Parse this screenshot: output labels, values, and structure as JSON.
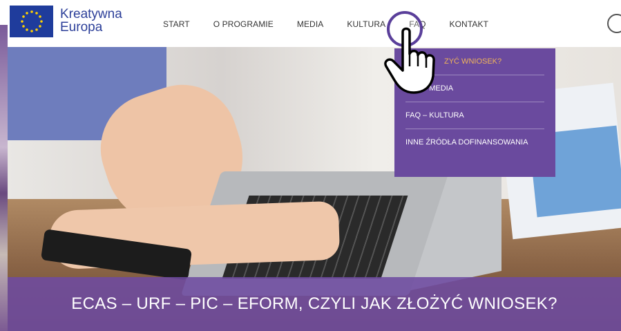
{
  "logo": {
    "line1": "Kreatywna",
    "line2": "Europa"
  },
  "nav": {
    "items": [
      {
        "label": "START"
      },
      {
        "label": "O PROGRAMIE"
      },
      {
        "label": "MEDIA"
      },
      {
        "label": "KULTURA"
      },
      {
        "label": "FAQ"
      },
      {
        "label": "KONTAKT"
      }
    ]
  },
  "dropdown": {
    "items": [
      {
        "label": "ZYĆ WNIOSEK?"
      },
      {
        "label": "FAQ – MEDIA"
      },
      {
        "label": "FAQ – KULTURA"
      },
      {
        "label": "INNE ŹRÓDŁA DOFINANSOWANIA"
      }
    ]
  },
  "caption": {
    "title": "ECAS – URF – PIC – EFORM, CZYLI JAK ZŁOŻYĆ WNIOSEK?"
  },
  "colors": {
    "brand": "#2c3f99",
    "accent": "#6a4a9e",
    "active": "#f0b45a"
  }
}
